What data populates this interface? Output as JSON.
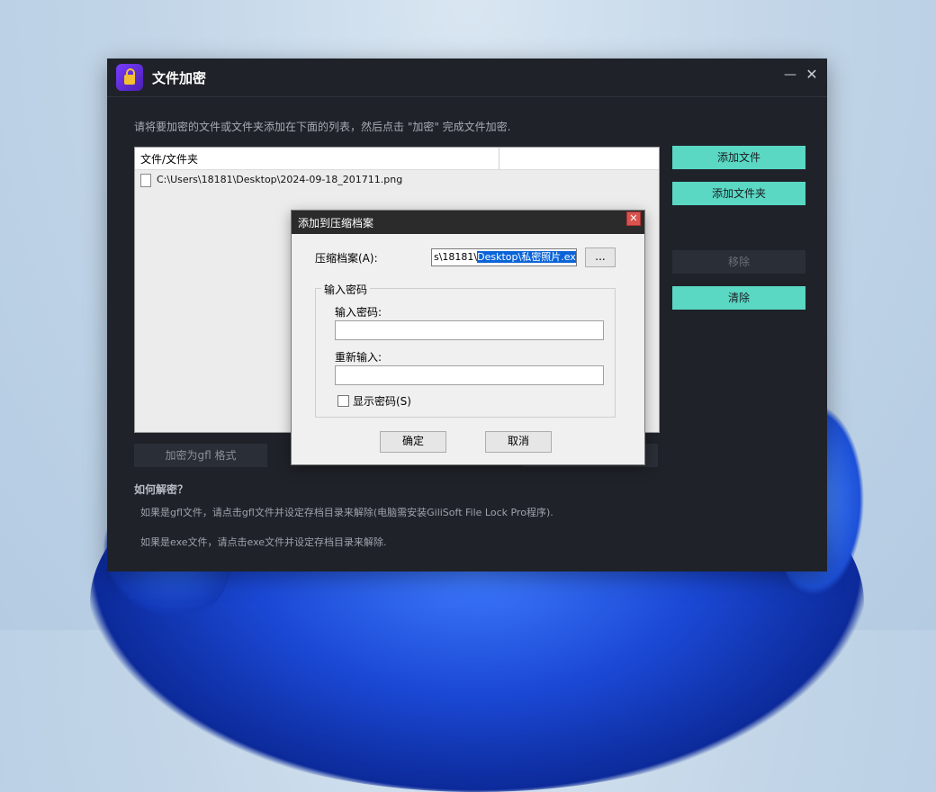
{
  "window": {
    "title": "文件加密",
    "minimize_glyph": "—",
    "close_glyph": "✕"
  },
  "instruction": "请将要加密的文件或文件夹添加在下面的列表，然后点击 \"加密\" 完成文件加密.",
  "file_list": {
    "header": "文件/文件夹",
    "items": [
      {
        "path": "C:\\Users\\18181\\Desktop\\2024-09-18_201711.png"
      }
    ]
  },
  "side_buttons": {
    "add_file": "添加文件",
    "add_folder": "添加文件夹",
    "remove": "移除",
    "clear": "清除"
  },
  "encrypt_as_gfl": "加密为gfl 格式",
  "howto": {
    "title": "如何解密？",
    "line1": "如果是gfl文件，请点击gfl文件并设定存档目录来解除(电脑需安装GiliSoft File Lock Pro程序).",
    "line2": "如果是exe文件，请点击exe文件并设定存档目录来解除."
  },
  "dialog": {
    "title": "添加到压缩档案",
    "close_glyph": "✕",
    "archive_label": "压缩档案(A):",
    "archive_value_plain": "s\\18181\\",
    "archive_value_selected": "Desktop\\私密照片.exe",
    "browse_label": "...",
    "group_legend": "输入密码",
    "password_label": "输入密码:",
    "reenter_label": "重新输入:",
    "show_password_label": "显示密码(S)",
    "show_password_checked": false,
    "ok_label": "确定",
    "cancel_label": "取消"
  },
  "colors": {
    "accent_teal": "#5ad8c4",
    "app_bg": "#1f2229",
    "selection_blue": "#0a64d8"
  }
}
